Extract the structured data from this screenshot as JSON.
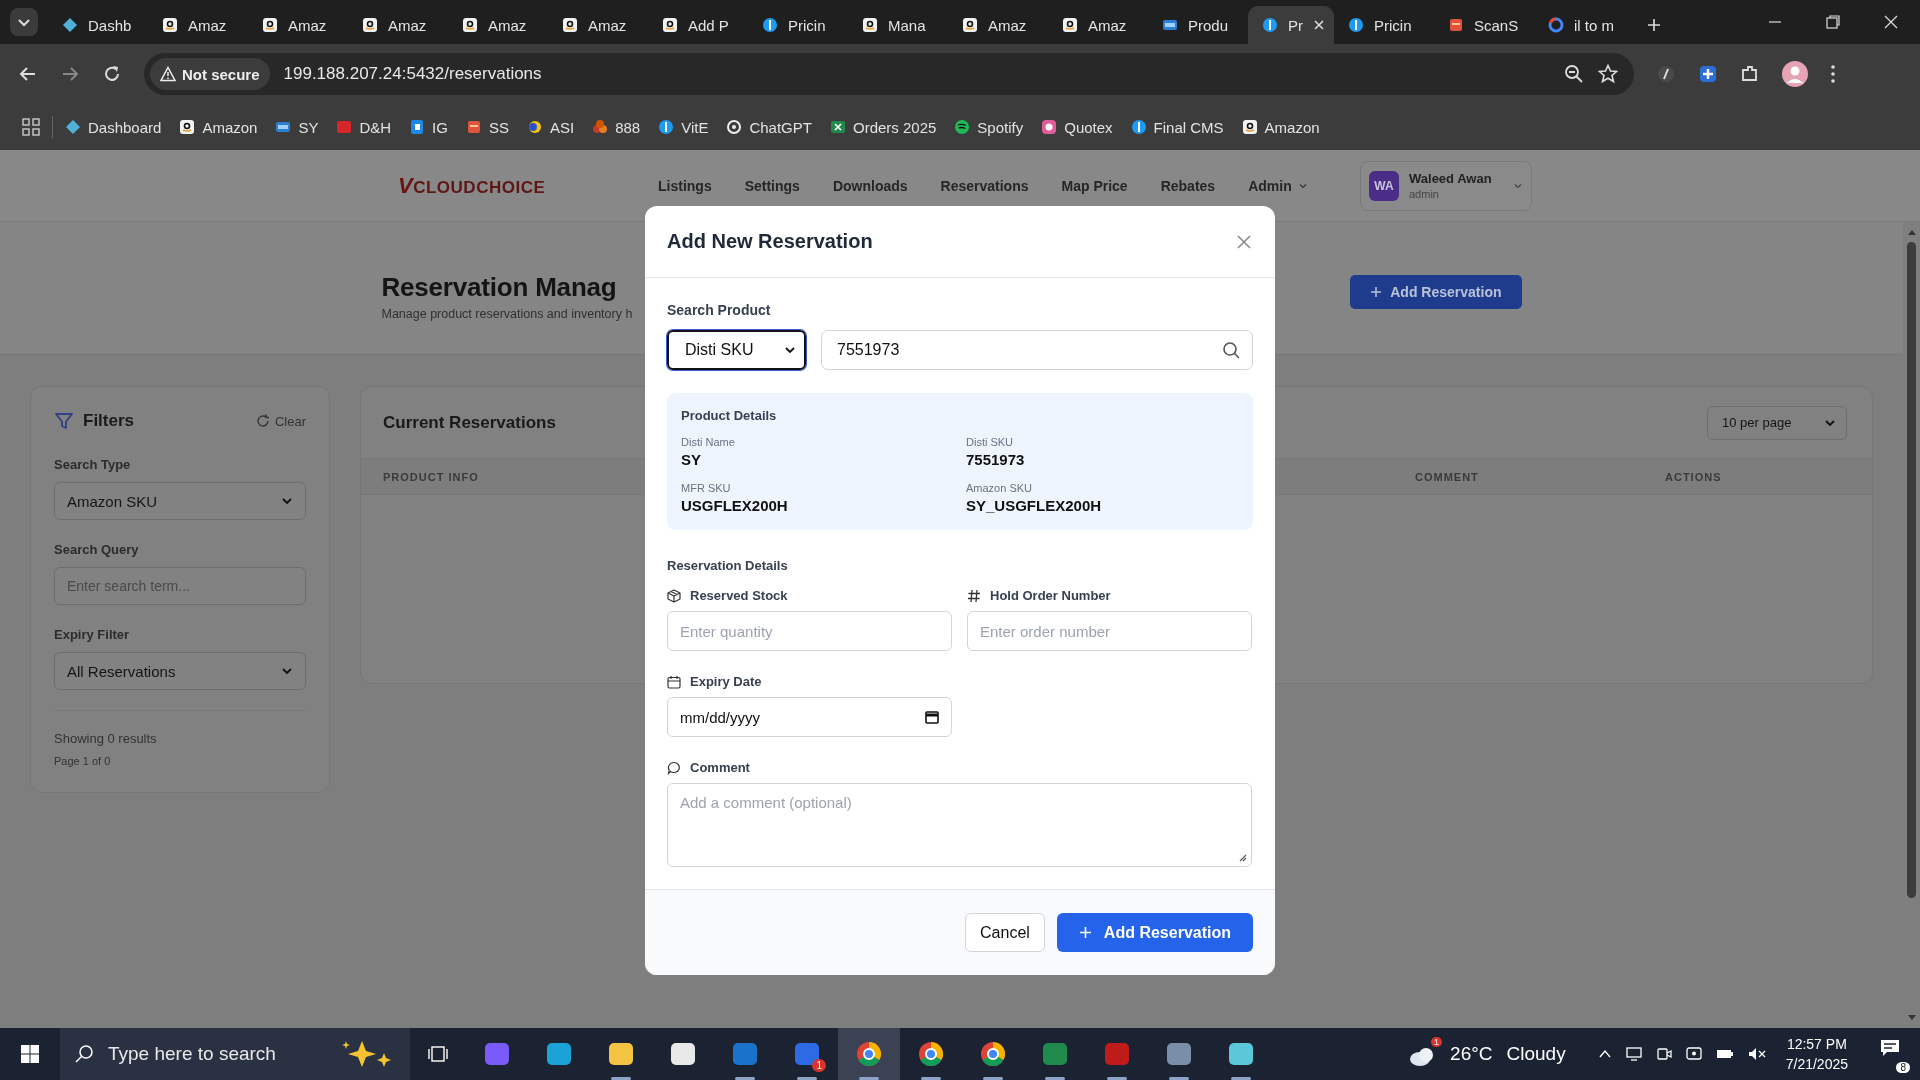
{
  "browser": {
    "tabs": [
      {
        "kind": "dashboard",
        "label": "Dashb",
        "selected": false
      },
      {
        "kind": "amazon",
        "label": "Amaz",
        "selected": false
      },
      {
        "kind": "amazon",
        "label": "Amaz",
        "selected": false
      },
      {
        "kind": "amazon",
        "label": "Amaz",
        "selected": false
      },
      {
        "kind": "amazon",
        "label": "Amaz",
        "selected": false
      },
      {
        "kind": "amazon",
        "label": "Amaz",
        "selected": false
      },
      {
        "kind": "amazon",
        "label": "Add P",
        "selected": false
      },
      {
        "kind": "dollar",
        "label": "Pricin",
        "selected": false
      },
      {
        "kind": "amazon",
        "label": "Mana",
        "selected": false
      },
      {
        "kind": "amazon",
        "label": "Amaz",
        "selected": false
      },
      {
        "kind": "amazon",
        "label": "Amaz",
        "selected": false
      },
      {
        "kind": "ec",
        "label": "Produ",
        "selected": false
      },
      {
        "kind": "dollar",
        "label": "Pr",
        "selected": true
      },
      {
        "kind": "dollar",
        "label": "Pricin",
        "selected": false
      },
      {
        "kind": "scan",
        "label": "ScanS",
        "selected": false
      },
      {
        "kind": "google",
        "label": "il to m",
        "selected": false
      }
    ],
    "security": "Not secure",
    "url": "199.188.207.24:5432/reservations",
    "bookmarks": [
      {
        "kind": "dashboard",
        "label": "Dashboard"
      },
      {
        "kind": "amazon",
        "label": "Amazon"
      },
      {
        "kind": "ec",
        "label": "SY"
      },
      {
        "kind": "dh",
        "label": "D&H"
      },
      {
        "kind": "ig",
        "label": "IG"
      },
      {
        "kind": "scan",
        "label": "SS"
      },
      {
        "kind": "asi",
        "label": "ASI"
      },
      {
        "kind": "n888",
        "label": "888"
      },
      {
        "kind": "dollar",
        "label": "VitE"
      },
      {
        "kind": "chatgpt",
        "label": "ChatGPT"
      },
      {
        "kind": "excel",
        "label": "Orders 2025"
      },
      {
        "kind": "spotify",
        "label": "Spotify"
      },
      {
        "kind": "quotex",
        "label": "Quotex"
      },
      {
        "kind": "dollar",
        "label": "Final CMS"
      },
      {
        "kind": "amazon",
        "label": "Amazon"
      }
    ]
  },
  "app": {
    "logo": {
      "mark": "V",
      "text": "CLOUDCHOICE"
    },
    "nav": [
      {
        "label": "Listings",
        "dropdown": false
      },
      {
        "label": "Settings",
        "dropdown": false
      },
      {
        "label": "Downloads",
        "dropdown": false
      },
      {
        "label": "Reservations",
        "dropdown": false
      },
      {
        "label": "Map Price",
        "dropdown": false
      },
      {
        "label": "Rebates",
        "dropdown": false
      },
      {
        "label": "Admin",
        "dropdown": true
      }
    ],
    "user": {
      "initials": "WA",
      "name": "Waleed Awan",
      "role": "admin"
    }
  },
  "page": {
    "title": "Reservation Manag",
    "subtitle": "Manage product reservations and inventory h",
    "add_button": "Add Reservation"
  },
  "filters": {
    "title": "Filters",
    "clear": "Clear",
    "fields": [
      {
        "kind": "select",
        "label": "Search Type",
        "value": "Amazon SKU"
      },
      {
        "kind": "input",
        "label": "Search Query",
        "placeholder": "Enter search term..."
      },
      {
        "kind": "select",
        "label": "Expiry Filter",
        "value": "All Reservations"
      }
    ],
    "results": "Showing 0 results",
    "page_info": "Page 1 of 0"
  },
  "reservations": {
    "title": "Current Reservations",
    "per_page": "10 per page",
    "columns": [
      "PRODUCT INFO",
      "COMMENT",
      "ACTIONS"
    ]
  },
  "modal": {
    "title": "Add New Reservation",
    "search_label": "Search Product",
    "search_type": "Disti SKU",
    "search_value": "7551973",
    "product": {
      "title": "Product Details",
      "fields": [
        {
          "label": "Disti Name",
          "value": "SY"
        },
        {
          "label": "Disti SKU",
          "value": "7551973"
        },
        {
          "label": "MFR SKU",
          "value": "USGFLEX200H"
        },
        {
          "label": "Amazon SKU",
          "value": "SY_USGFLEX200H"
        }
      ]
    },
    "section": "Reservation Details",
    "fields": [
      {
        "kind": "quantity",
        "label": "Reserved Stock",
        "placeholder": "Enter quantity"
      },
      {
        "kind": "order",
        "label": "Hold Order Number",
        "placeholder": "Enter order number"
      },
      {
        "kind": "date",
        "label": "Expiry Date",
        "value": "mm/dd/yyyy"
      },
      {
        "kind": "comment",
        "label": "Comment",
        "placeholder": "Add a comment (optional)"
      }
    ],
    "buttons": [
      {
        "kind": "secondary",
        "label": "Cancel"
      },
      {
        "kind": "primary",
        "label": "Add Reservation"
      }
    ]
  },
  "taskbar": {
    "search": "Type here to search",
    "apps": [
      {
        "kind": "copilot",
        "running": false,
        "selected": false
      },
      {
        "kind": "edge",
        "running": false,
        "selected": false
      },
      {
        "kind": "folder",
        "running": true,
        "selected": false
      },
      {
        "kind": "store",
        "running": false,
        "selected": false
      },
      {
        "kind": "outlook",
        "running": true,
        "selected": false
      },
      {
        "kind": "zoom",
        "running": true,
        "selected": false,
        "badge": "1"
      },
      {
        "kind": "chrome",
        "running": true,
        "selected": true
      },
      {
        "kind": "chrome",
        "running": true,
        "selected": false
      },
      {
        "kind": "chrome",
        "running": true,
        "selected": false
      },
      {
        "kind": "excel",
        "running": true,
        "selected": false
      },
      {
        "kind": "filezilla",
        "running": true,
        "selected": false
      },
      {
        "kind": "calculator",
        "running": true,
        "selected": false
      },
      {
        "kind": "gem",
        "running": true,
        "selected": false
      }
    ],
    "weather_badge": "1",
    "temperature": "26°C",
    "condition": "Cloudy",
    "time": "12:57 PM",
    "date": "7/21/2025",
    "notifications": "8"
  }
}
